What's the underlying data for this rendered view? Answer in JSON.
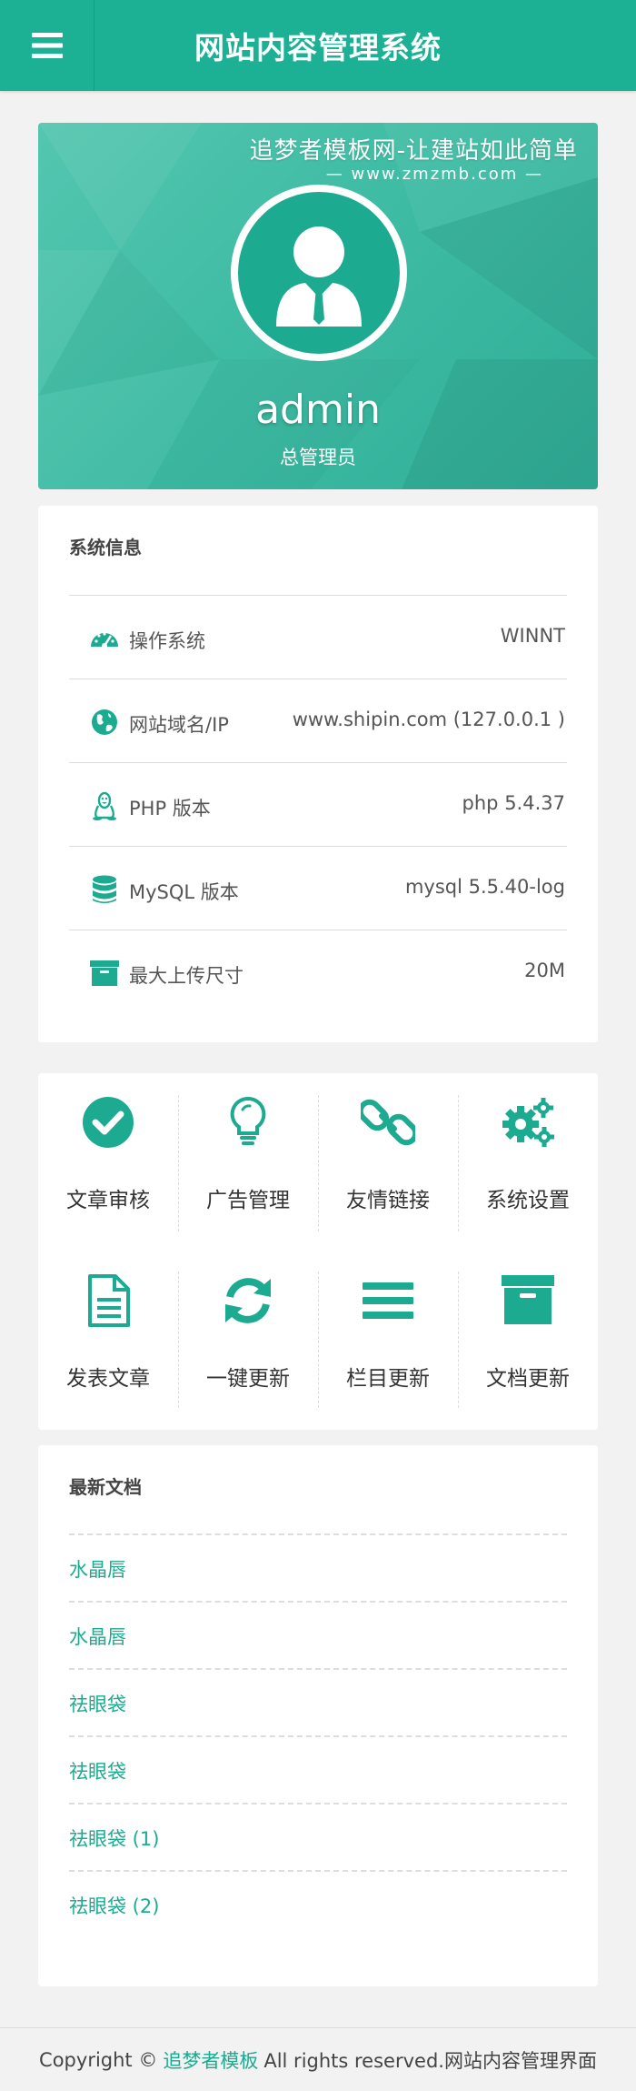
{
  "header": {
    "title": "网站内容管理系统",
    "menu_icon": "hamburger-icon"
  },
  "profile": {
    "banner_title": "追梦者模板网-让建站如此简单",
    "banner_url": "— www.zmzmb.com —",
    "username": "admin",
    "role": "总管理员"
  },
  "system_info": {
    "title": "系统信息",
    "rows": [
      {
        "icon": "dashboard-icon",
        "label": "操作系统",
        "value": "WINNT"
      },
      {
        "icon": "globe-icon",
        "label": "网站域名/IP",
        "value": "www.shipin.com (127.0.0.1 )"
      },
      {
        "icon": "linux-icon",
        "label": "PHP 版本",
        "value": "php 5.4.37"
      },
      {
        "icon": "database-icon",
        "label": "MySQL 版本",
        "value": "mysql 5.5.40-log"
      },
      {
        "icon": "archive-icon",
        "label": "最大上传尺寸",
        "value": "20M"
      }
    ]
  },
  "shortcuts": [
    {
      "icon": "check-circle-icon",
      "label": "文章审核"
    },
    {
      "icon": "lightbulb-icon",
      "label": "广告管理"
    },
    {
      "icon": "chain-link-icon",
      "label": "友情链接"
    },
    {
      "icon": "gears-icon",
      "label": "系统设置"
    },
    {
      "icon": "document-icon",
      "label": "发表文章"
    },
    {
      "icon": "refresh-icon",
      "label": "一键更新"
    },
    {
      "icon": "bars-icon",
      "label": "栏目更新"
    },
    {
      "icon": "archive-icon",
      "label": "文档更新"
    }
  ],
  "latest_docs": {
    "title": "最新文档",
    "items": [
      "水晶唇",
      "水晶唇",
      "祛眼袋",
      "祛眼袋",
      "祛眼袋 (1)",
      "祛眼袋 (2)"
    ]
  },
  "footer": {
    "prefix": "Copyright ©",
    "brand": "追梦者模板",
    "suffix": "All rights reserved.网站内容管理界面"
  },
  "colors": {
    "accent": "#1cb195",
    "link": "#1cab90"
  }
}
